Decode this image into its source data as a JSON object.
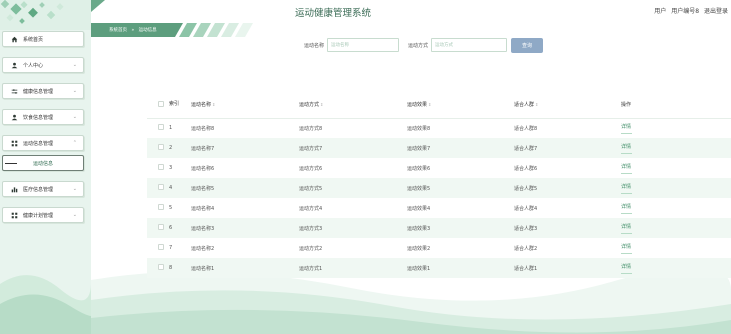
{
  "app_title": "运动健康管理系统",
  "user_bar": {
    "role_label": "用户",
    "username": "用户编号8",
    "logout": "退出登录"
  },
  "breadcrumb": {
    "home": "系统首页",
    "separator": "»",
    "current": "运动信息"
  },
  "sidebar": {
    "items": [
      {
        "label": "系统首页",
        "icon": "home-icon"
      },
      {
        "label": "个人中心",
        "icon": "user-icon",
        "chevron": "⌄"
      },
      {
        "label": "健康信息管理",
        "icon": "sliders-icon",
        "chevron": "⌄"
      },
      {
        "label": "饮食信息管理",
        "icon": "user-icon",
        "chevron": "⌄"
      },
      {
        "label": "运动信息管理",
        "icon": "grid-icon",
        "chevron": "⌃"
      },
      {
        "label": "运动信息",
        "sub": true
      },
      {
        "label": "医疗信息管理",
        "icon": "bar-chart-icon",
        "chevron": "⌄"
      },
      {
        "label": "健康计划管理",
        "icon": "grid-icon",
        "chevron": "⌄"
      }
    ]
  },
  "search": {
    "field1_label": "运动名称",
    "field1_placeholder": "运动名称",
    "field2_label": "运动方式",
    "field2_placeholder": "运动方式",
    "button": "查询"
  },
  "table": {
    "headers": {
      "seq": "索引",
      "name": "运动名称",
      "method": "运动方式",
      "effect": "运动效果",
      "crowd": "适合人群",
      "action": "操作"
    },
    "sort_glyph": "⇕",
    "rows": [
      {
        "seq": "1",
        "name": "运动名称8",
        "method": "运动方式8",
        "effect": "运动效果8",
        "crowd": "适合人群8",
        "action": "详情"
      },
      {
        "seq": "2",
        "name": "运动名称7",
        "method": "运动方式7",
        "effect": "运动效果7",
        "crowd": "适合人群7",
        "action": "详情"
      },
      {
        "seq": "3",
        "name": "运动名称6",
        "method": "运动方式6",
        "effect": "运动效果6",
        "crowd": "适合人群6",
        "action": "详情"
      },
      {
        "seq": "4",
        "name": "运动名称5",
        "method": "运动方式5",
        "effect": "运动效果5",
        "crowd": "适合人群5",
        "action": "详情"
      },
      {
        "seq": "5",
        "name": "运动名称4",
        "method": "运动方式4",
        "effect": "运动效果4",
        "crowd": "适合人群4",
        "action": "详情"
      },
      {
        "seq": "6",
        "name": "运动名称3",
        "method": "运动方式3",
        "effect": "运动效果3",
        "crowd": "适合人群3",
        "action": "详情"
      },
      {
        "seq": "7",
        "name": "运动名称2",
        "method": "运动方式2",
        "effect": "运动效果2",
        "crowd": "适合人群2",
        "action": "详情"
      },
      {
        "seq": "8",
        "name": "运动名称1",
        "method": "运动方式1",
        "effect": "运动效果1",
        "crowd": "适合人群1",
        "action": "详情"
      }
    ]
  },
  "colors": {
    "accent": "#3a8a63",
    "sidebar_bg": "#e8f4ee",
    "breadcrumb_band": "#6aa98a",
    "search_button": "#8fa9c6",
    "title": "#3a6b55"
  }
}
